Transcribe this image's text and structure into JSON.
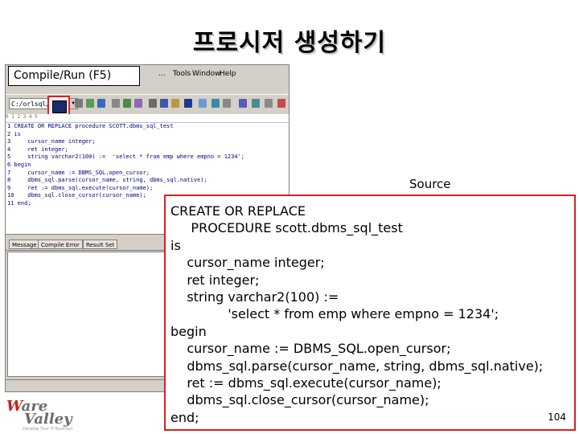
{
  "slide": {
    "title": "프로시저 생성하기",
    "page_number": "104"
  },
  "ide": {
    "menu": [
      "...",
      "Tools",
      "Window",
      "Help"
    ],
    "schema_combo_value": "C:/orlsql/",
    "ruler_text": "0         1         2         3         4         5",
    "editor_lines": [
      "1 CREATE OR REPLACE procedure SCOTT.dbms_sql_test",
      "2 is",
      "3     cursor_name integer;",
      "4     ret integer;",
      "5     string varchar2(100) :=  'select * from emp where empno = 1234';",
      "6 begin",
      "7     cursor_name := DBMS_SQL.open_cursor;",
      "8     dbms_sql.parse(cursor_name, string, dbms_sql.native);",
      "9     ret := dbms_sql.execute(cursor_name);",
      "10    dbms_sql.close_cursor(cursor_name);",
      "11 end;"
    ],
    "output_tabs": [
      "Message",
      "Compile Error",
      "Result Set"
    ]
  },
  "callouts": {
    "compile_run": "Compile/Run (F5)",
    "source": "Source"
  },
  "source_code": [
    "CREATE OR REPLACE",
    "     PROCEDURE scott.dbms_sql_test",
    "is",
    "    cursor_name integer;",
    "    ret integer;",
    "    string varchar2(100) :=",
    "              'select * from emp where empno = 1234';",
    "begin",
    "    cursor_name := DBMS_SQL.open_cursor;",
    "    dbms_sql.parse(cursor_name, string, dbms_sql.native);",
    "    ret := dbms_sql.execute(cursor_name);",
    "    dbms_sql.close_cursor(cursor_name);",
    "end;"
  ],
  "logo": {
    "name_top": "Ware",
    "name_bottom": "Valley",
    "tagline": "Develop Your IT Business"
  },
  "colors": {
    "highlight_red": "#d82020",
    "ide_face": "#d4d0c8",
    "logo_red": "#c8201e"
  }
}
